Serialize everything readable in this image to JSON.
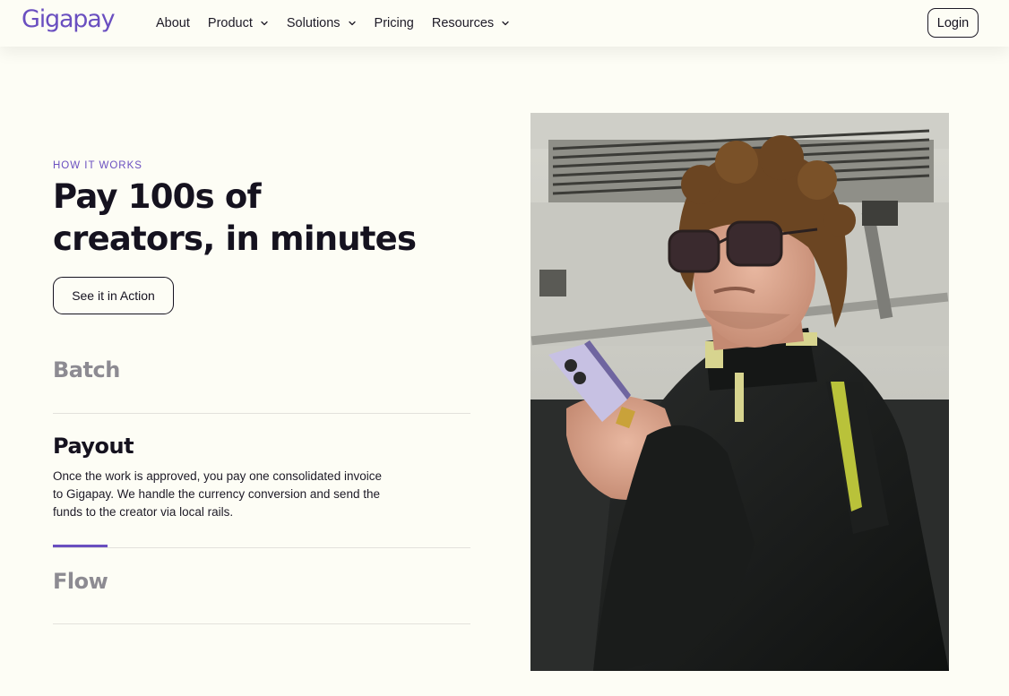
{
  "header": {
    "logo": "Gigapay",
    "nav": [
      {
        "label": "About",
        "has_dropdown": false
      },
      {
        "label": "Product",
        "has_dropdown": true
      },
      {
        "label": "Solutions",
        "has_dropdown": true
      },
      {
        "label": "Pricing",
        "has_dropdown": false
      },
      {
        "label": "Resources",
        "has_dropdown": true
      }
    ],
    "login_label": "Login"
  },
  "hero": {
    "eyebrow": "HOW IT WORKS",
    "headline_line1": "Pay 100s of",
    "headline_line2": "creators, in minutes",
    "cta_label": "See it in Action"
  },
  "steps": [
    {
      "title": "Batch",
      "active": false,
      "body": ""
    },
    {
      "title": "Payout",
      "active": true,
      "body": "Once the work is approved, you pay one consolidated invoice to Gigapay. We handle the currency conversion and send the funds to the creator via local rails."
    },
    {
      "title": "Flow",
      "active": false,
      "body": ""
    }
  ],
  "active_step_progress": 0.13,
  "colors": {
    "brand": "#6a4fc0",
    "background": "#fdfdf5",
    "text": "#15121f",
    "inactive_text": "#8d8b92"
  },
  "icons": {
    "dropdown": "chevron-down-icon"
  }
}
